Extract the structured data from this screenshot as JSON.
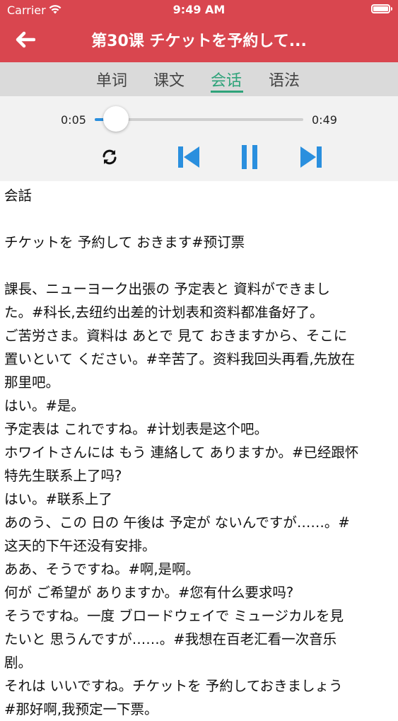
{
  "status_bar": {
    "carrier": "Carrier",
    "time": "9:49 AM"
  },
  "nav": {
    "title": "第30课 チケットを予約して...",
    "back_icon": "arrow-left-icon"
  },
  "tabs": [
    {
      "label": "单词",
      "active": false
    },
    {
      "label": "课文",
      "active": false
    },
    {
      "label": "会话",
      "active": true
    },
    {
      "label": "语法",
      "active": false
    }
  ],
  "player": {
    "current_time": "0:05",
    "total_time": "0:49",
    "progress": 0.1,
    "controls": [
      "repeat-icon",
      "previous-icon",
      "pause-icon",
      "next-icon"
    ]
  },
  "colors": {
    "header": "#d9464f",
    "tab_active": "#2fa37a",
    "player_accent": "#2a8fde"
  },
  "content": {
    "lines": [
      "会話",
      "",
      "チケットを 予約して おきます#预订票",
      "",
      "課長、ニューヨーク出張の 予定表と 資料ができまし",
      "た。#科长,去纽约出差的计划表和资料都准备好了。",
      "ご苦労さま。資料は あとで 見て おきますから、そこに",
      "置いといて ください。#辛苦了。资料我回头再看,先放在",
      "那里吧。",
      "はい。#是。",
      "予定表は これですね。#计划表是这个吧。",
      "ホワイトさんには もう 連絡して ありますか。#已经跟怀",
      "特先生联系上了吗?",
      "はい。#联系上了",
      "あのう、この 日の 午後は 予定が ないんですが……。#",
      "这天的下午还没有安排。",
      "ああ、そうですね。#啊,是啊。",
      "何が ご希望が ありますか。#您有什么要求吗?",
      "そうですね。一度 ブロードウェイで ミュージカルを見",
      "たいと 思うんですが……。#我想在百老汇看一次音乐",
      "剧。",
      "それは いいですね。チケットを 予約しておきましょう",
      "#那好啊,我预定一下票。"
    ]
  }
}
